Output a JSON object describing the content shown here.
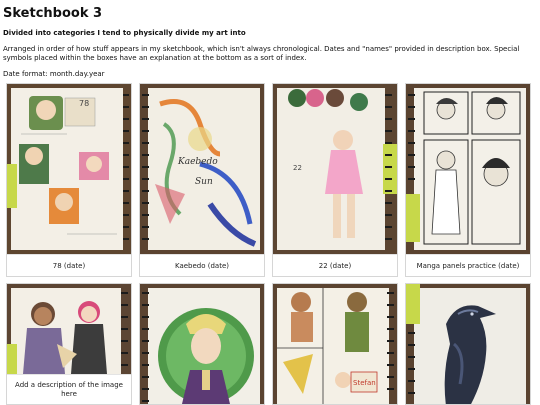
{
  "header": {
    "title": "Sketchbook 3",
    "subtitle": "Divided into categories I tend to physically divide my art into",
    "intro": "Arranged in order of how stuff appears in my sketchbook, which isn't always chronological. Dates and \"names\" provided in description box. Special symbols placed within the boxes have an explanation at the bottom as a sort of index.",
    "date_format": "Date format: month.day.year"
  },
  "gallery": {
    "row1": [
      {
        "caption": "78 (date)"
      },
      {
        "caption": "Kaebedo (date)"
      },
      {
        "caption": "22 (date)"
      },
      {
        "caption": "Manga panels practice (date)"
      }
    ],
    "row2": [
      {
        "caption": "Add a description of the image here"
      }
    ]
  },
  "artwork_text": {
    "page1_number": "78",
    "page2_script": "Kaebedo",
    "page2_sub": "Sun",
    "page3_number": "22",
    "page7_name": "Stefan"
  },
  "colors": {
    "paper": "#f4f1ea",
    "binding": "#1b1b1b",
    "green_tape": "#c7d84a",
    "background": "#5e4630"
  }
}
